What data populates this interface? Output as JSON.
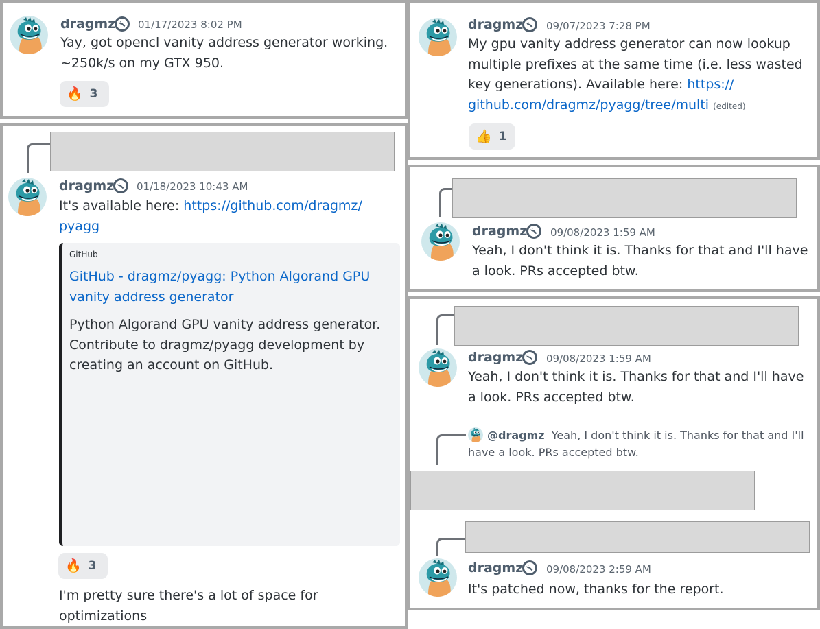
{
  "username": "dragmz",
  "colors": {
    "link": "#0b67c9",
    "redaction": "#d9d9d9",
    "panel_border": "#a9a9a9",
    "embed_bar": "#1e1f22"
  },
  "icons": {
    "avatar": "dinosaur-avatar",
    "role": "wrench-icon"
  },
  "p1": {
    "timestamp": "01/17/2023 8:02 PM",
    "lines": [
      "Yay, got opencl vanity address generator working.",
      "~250k/s on my GTX 950."
    ],
    "reaction": {
      "emoji": "🔥",
      "count": "3"
    }
  },
  "p2": {
    "timestamp": "01/18/2023 10:43 AM",
    "text_prefix": "It's available here: ",
    "link_line1": "https://github.com/dragmz/",
    "link_line2": "pyagg",
    "embed": {
      "provider": "GitHub",
      "title": "GitHub - dragmz/pyagg: Python Algorand GPU vanity address generator",
      "description": "Python Algorand GPU vanity address generator. Contribute to dragmz/pyagg development by creating an account on GitHub."
    },
    "reaction": {
      "emoji": "🔥",
      "count": "3"
    },
    "followup": "I'm pretty sure there's a lot of space for optimizations"
  },
  "p3": {
    "timestamp": "09/07/2023 7:28 PM",
    "line1": "My gpu vanity address generator can now lookup",
    "line2": "multiple prefixes at the same time (i.e. less wasted",
    "line3_prefix": "key generations). Available here: ",
    "link_part1": "https://",
    "link_part2": "github.com/dragmz/pyagg/tree/multi",
    "edited": "(edited)",
    "reaction": {
      "emoji": "👍",
      "count": "1"
    }
  },
  "p4": {
    "timestamp": "09/08/2023 1:59 AM",
    "text": "Yeah, I don't think it is. Thanks for that and I'll have a look. PRs accepted btw."
  },
  "p5": {
    "msg1": {
      "timestamp": "09/08/2023 1:59 AM",
      "text": "Yeah, I don't think it is. Thanks for that and I'll have a look. PRs accepted btw."
    },
    "reply_preview": {
      "mention": "@dragmz",
      "text": "Yeah, I don't think it is. Thanks for that and I'll have a look. PRs accepted btw."
    },
    "msg2": {
      "timestamp": "09/08/2023 2:59 AM",
      "text": "It's patched now, thanks for the report."
    }
  }
}
